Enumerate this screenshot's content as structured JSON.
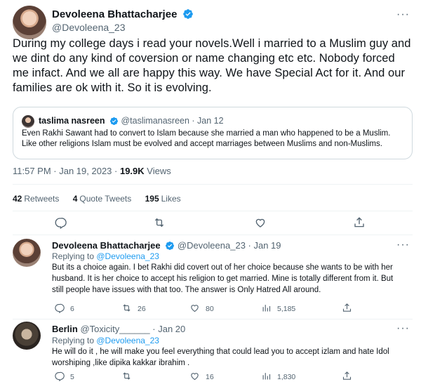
{
  "main_tweet": {
    "author_name": "Devoleena Bhattacharjee",
    "author_handle": "@Devoleena_23",
    "more_label": "···",
    "text": "During my college days i read your novels.Well i married to a Muslim guy and we dint do any kind of coversion or name changing etc etc. Nobody forced me infact. And we all are happy this way. We have Special Act for it. And our families are ok with it. So it is evolving.",
    "time": "11:57 PM · Jan 19, 2023 · ",
    "views_count": "19.9K",
    "views_label": " Views",
    "stats": {
      "retweets_count": "42",
      "retweets_label": "Retweets",
      "quotes_count": "4",
      "quotes_label": "Quote Tweets",
      "likes_count": "195",
      "likes_label": "Likes"
    }
  },
  "quoted_tweet": {
    "author_name": "taslima nasreen",
    "author_handle": "@taslimanasreen",
    "date": " · Jan 12",
    "text": "Even Rakhi Sawant  had to convert to Islam because she married a man who happened to be a Muslim. Like other religions Islam must be evolved and accept marriages between Muslims and non-Muslims."
  },
  "replies": [
    {
      "author_name": "Devoleena Bhattacharjee",
      "author_handle": "@Devoleena_23",
      "date": " · Jan 19",
      "replying_to_label": "Replying to ",
      "replying_to_handle": "@Devoleena_23",
      "text": "But its a choice again. I bet Rakhi did covert out of her choice because she wants to be with her husband. It is her choice to accept his religion to get married. Mine is totally different from it. But still people have issues with that too. The answer is Only Hatred All around.",
      "reply_count": "6",
      "retweet_count": "26",
      "like_count": "80",
      "view_count": "5,185"
    },
    {
      "author_name": "Berlin",
      "author_handle": "@Toxicity______",
      "date": " · Jan 20",
      "replying_to_label": "Replying to ",
      "replying_to_handle": "@Devoleena_23",
      "text": "He will do it , he will make you feel everything that could lead you to accept izlam and hate Idol worshiping ,like dipika kakkar ibrahim .",
      "reply_count": "5",
      "retweet_count": "",
      "like_count": "16",
      "view_count": "1,830"
    }
  ],
  "colors": {
    "verified": "#1d9bf0",
    "link": "#1d9bf0",
    "secondary_text": "#536471",
    "divider": "#eff3f4"
  },
  "icons": [
    "verified-badge-icon",
    "reply-icon",
    "retweet-icon",
    "like-icon",
    "share-icon",
    "views-icon",
    "more-icon"
  ]
}
